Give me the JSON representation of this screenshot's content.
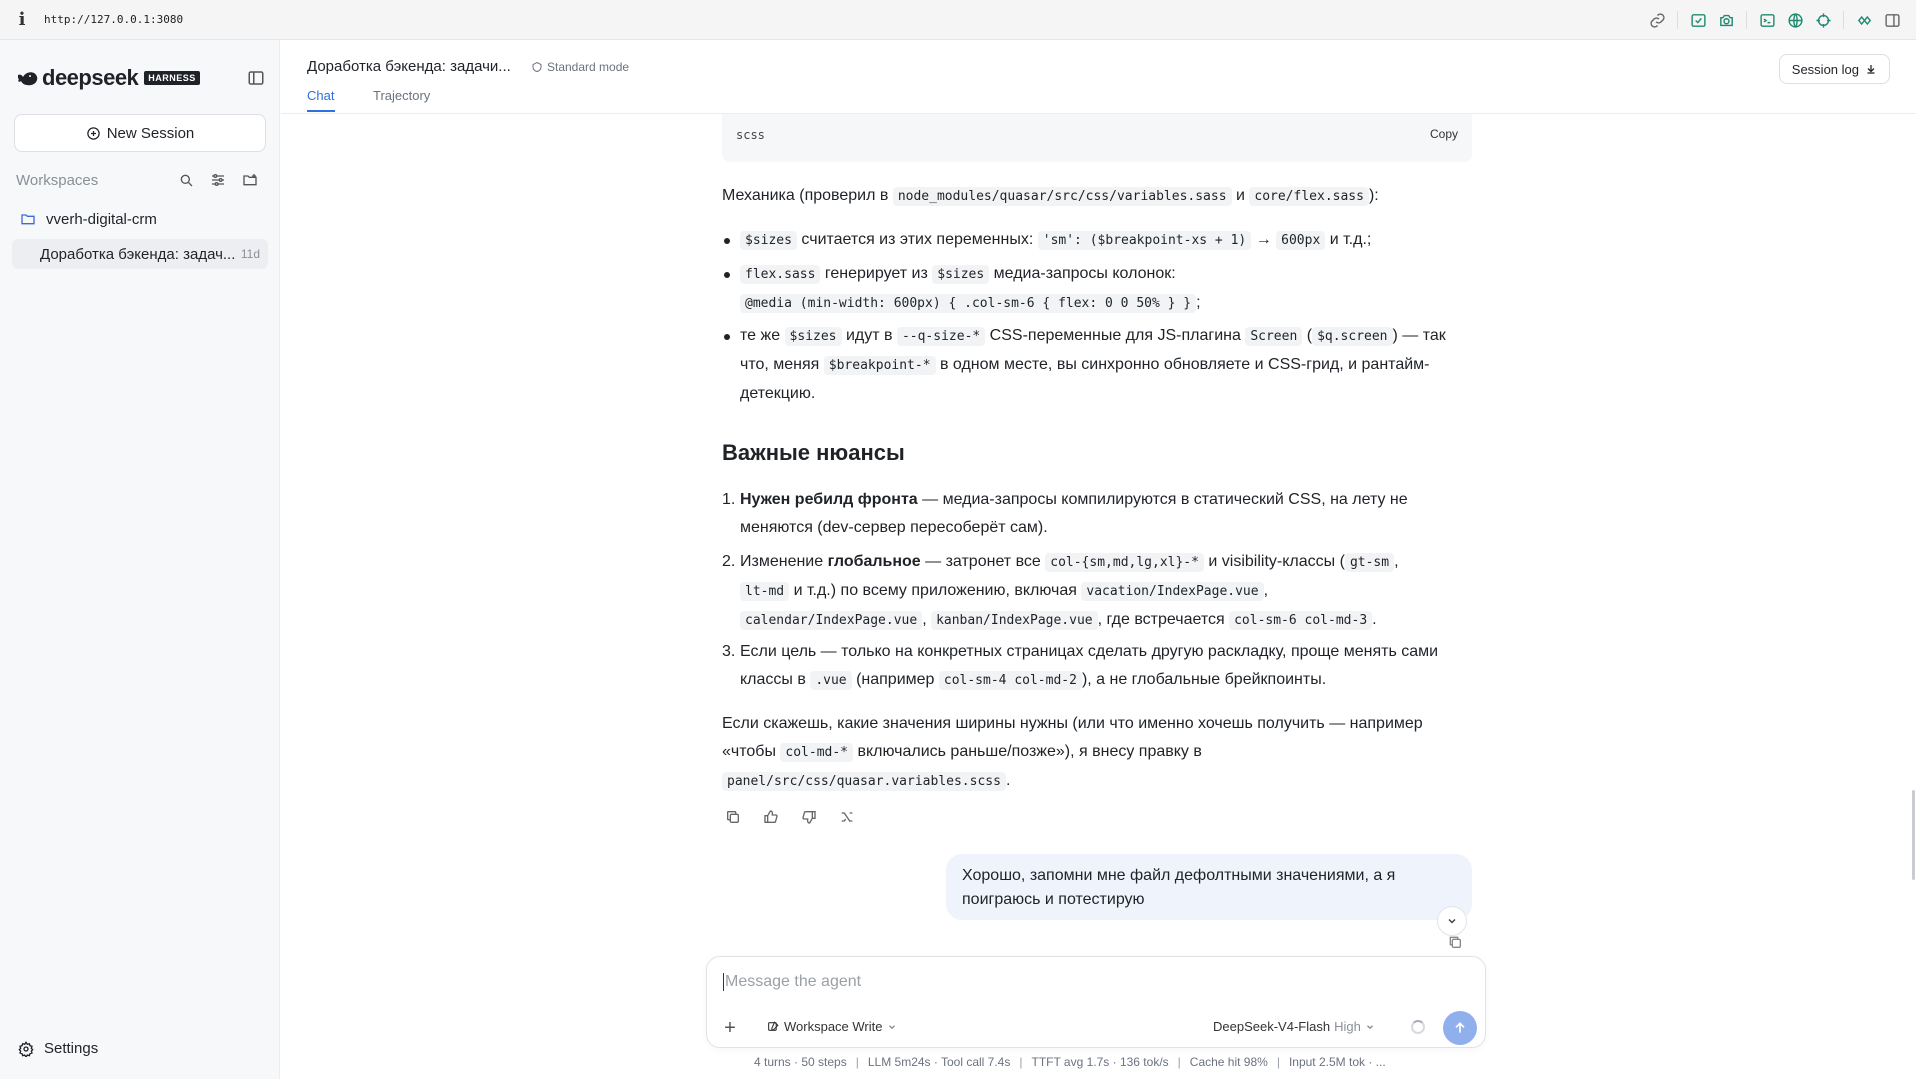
{
  "browser": {
    "url": "http://127.0.0.1:3080",
    "tools": [
      "link-icon",
      "screenshot-icon",
      "camera-icon",
      "terminal-icon",
      "globe-icon",
      "target-icon",
      "extensions-icon",
      "sidebar-toggle-icon"
    ]
  },
  "sidebar": {
    "brand": "deepseek",
    "badge": "HARNESS",
    "new_session": "New Session",
    "workspaces_label": "Workspaces",
    "workspace": "vverh-digital-crm",
    "session": {
      "title": "Доработка бэкенда: задач...",
      "age": "11d"
    },
    "settings": "Settings"
  },
  "header": {
    "title": "Доработка бэкенда: задачи...",
    "mode": "Standard mode",
    "tabs": [
      {
        "label": "Chat",
        "active": true
      },
      {
        "label": "Trajectory",
        "active": false
      }
    ],
    "session_log": "Session log"
  },
  "message": {
    "code_lang": "scss",
    "copy": "Copy",
    "mech": {
      "t1": "Механика (проверил в ",
      "c1": "node_modules/quasar/src/css/variables.sass",
      "t2": " и ",
      "c2": "core/flex.sass",
      "t3": "):"
    },
    "bullets": [
      {
        "c1": "$sizes",
        "t1": " считается из этих переменных: ",
        "c2": "'sm': ($breakpoint-xs + 1)",
        "t2": " → ",
        "c3": "600px",
        "t3": " и т.д.;"
      },
      {
        "c1": "flex.sass",
        "t1": " генерирует из ",
        "c2": "$sizes",
        "t2": " медиа-запросы колонок:",
        "c3": "@media (min-width: 600px) { .col-sm-6 { flex: 0 0 50% } }",
        "t3": ";"
      },
      {
        "t0": "те же ",
        "c1": "$sizes",
        "t1": " идут в ",
        "c2": "--q-size-*",
        "t2": " CSS-переменные для JS-плагина ",
        "c3": "Screen",
        "t3": " (",
        "c4": "$q.screen",
        "t4": ") — так что, меняя ",
        "c5": "$breakpoint-*",
        "t5": " в одном месте, вы синхронно обновляете и CSS-грид, и рантайм-детекцию."
      }
    ],
    "heading": "Важные нюансы",
    "items": [
      {
        "n": "1.",
        "b": "Нужен ребилд фронта",
        "t1": " — медиа-запросы компилируются в статический CSS, на лету не меняются (dev-сервер пересоберёт сам)."
      },
      {
        "n": "2.",
        "t0": "Изменение ",
        "b": "глобальное",
        "t1": " — затронет все ",
        "c1": "col-{sm,md,lg,xl}-*",
        "t2": " и visibility-классы (",
        "c2": "gt-sm",
        "t3": ",",
        "c3": "lt-md",
        "t4": " и т.д.) по всему приложению, включая ",
        "c4": "vacation/IndexPage.vue",
        "t5": ",",
        "c5": "calendar/IndexPage.vue",
        "t6": ", ",
        "c6": "kanban/IndexPage.vue",
        "t7": ", где встречается ",
        "c7": "col-sm-6 col-md-3",
        "t8": "."
      },
      {
        "n": "3.",
        "t0": "Если цель — только на конкретных страницах сделать другую раскладку, проще менять сами классы в ",
        "c1": ".vue",
        "t1": " (например ",
        "c2": "col-sm-4 col-md-2",
        "t2": "), а не глобальные брейкпоинты."
      }
    ],
    "closing": {
      "t1": "Если скажешь, какие значения ширины нужны (или что именно хочешь получить — например «чтобы ",
      "c1": "col-md-*",
      "t2": " включались раньше/позже»), я внесу правку в",
      "c2": "panel/src/css/quasar.variables.scss",
      "t3": "."
    }
  },
  "user_message": "Хорошо, запомни мне файл дефолтными значениями, а я поиграюсь и потестирую",
  "composer": {
    "placeholder": "Message the agent",
    "workspace_mode": "Workspace Write",
    "model": "DeepSeek-V4-Flash",
    "effort": "High"
  },
  "stats": [
    "4 turns · 50 steps",
    "LLM 5m24s · Tool call 7.4s",
    "TTFT avg 1.7s · 136 tok/s",
    "Cache hit 98%",
    "Input 2.5M tok · ..."
  ]
}
